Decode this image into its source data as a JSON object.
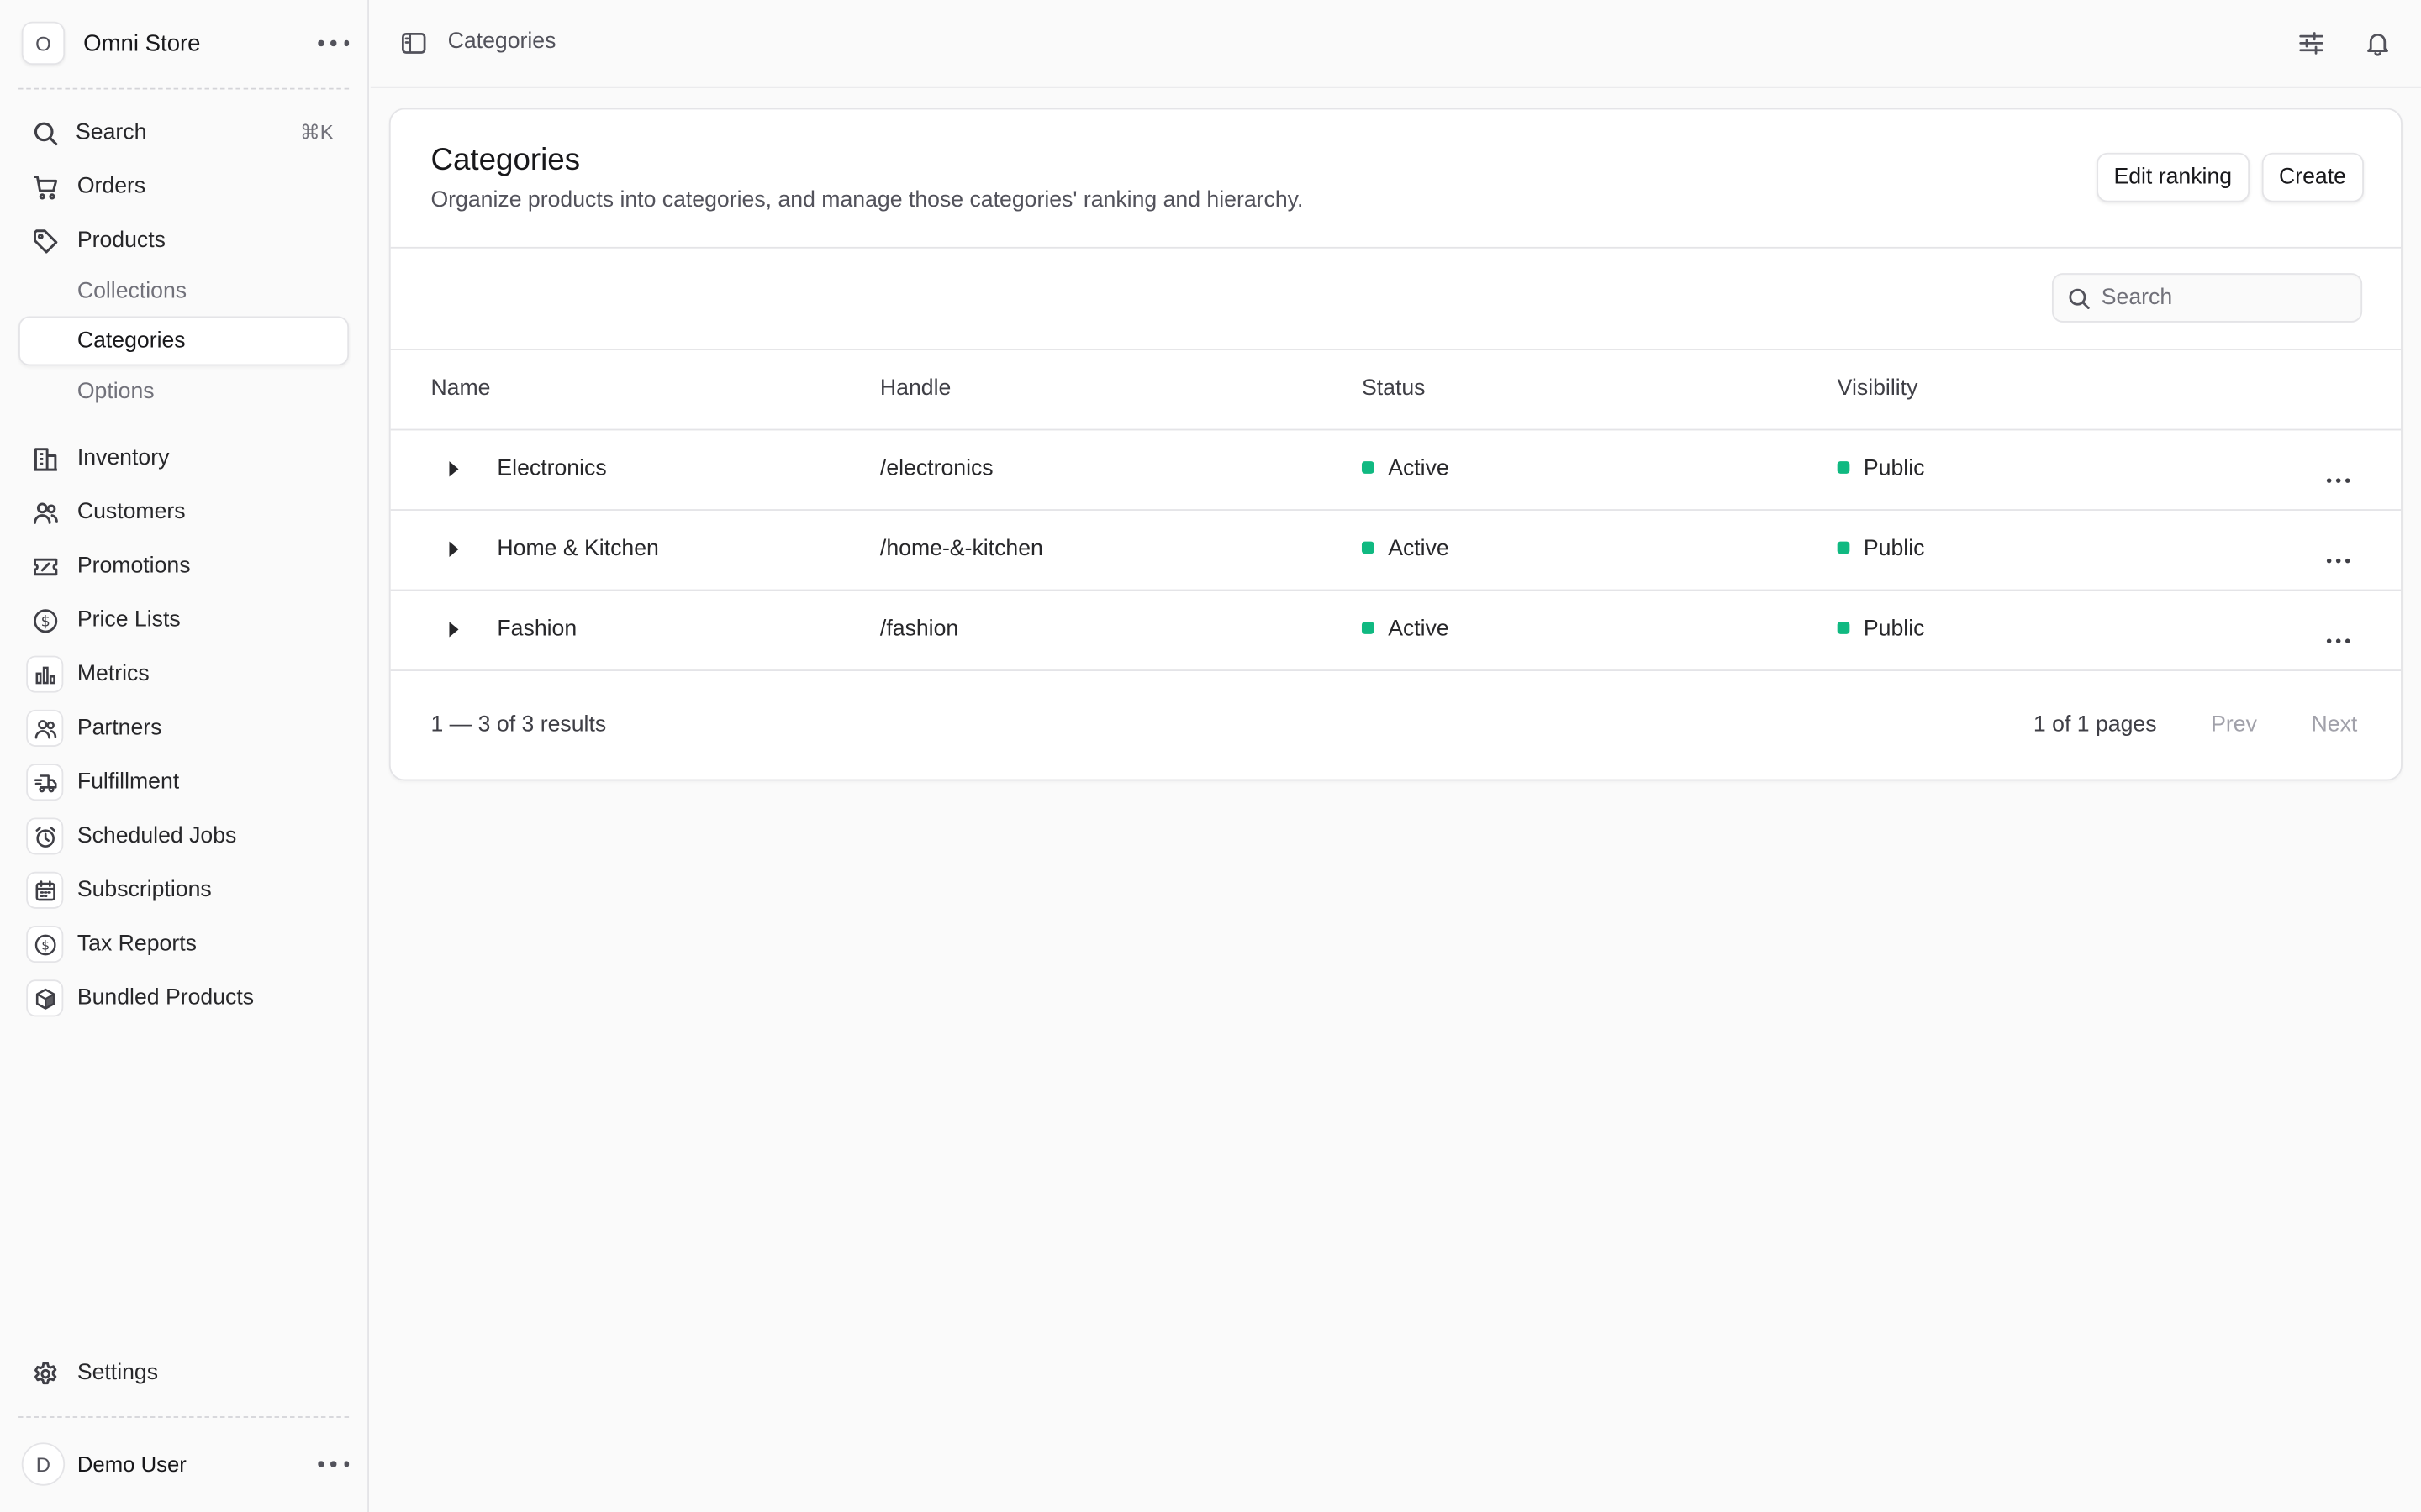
{
  "sidebar": {
    "store_avatar": "O",
    "store_name": "Omni Store",
    "search_label": "Search",
    "search_shortcut": "⌘K",
    "items": [
      {
        "label": "Orders"
      },
      {
        "label": "Products"
      },
      {
        "label": "Collections"
      },
      {
        "label": "Categories"
      },
      {
        "label": "Options"
      },
      {
        "label": "Inventory"
      },
      {
        "label": "Customers"
      },
      {
        "label": "Promotions"
      },
      {
        "label": "Price Lists"
      },
      {
        "label": "Metrics"
      },
      {
        "label": "Partners"
      },
      {
        "label": "Fulfillment"
      },
      {
        "label": "Scheduled Jobs"
      },
      {
        "label": "Subscriptions"
      },
      {
        "label": "Tax Reports"
      },
      {
        "label": "Bundled Products"
      }
    ],
    "settings_label": "Settings",
    "user_avatar": "D",
    "user_name": "Demo User"
  },
  "topbar": {
    "breadcrumb": "Categories"
  },
  "page": {
    "title": "Categories",
    "description": "Organize products into categories, and manage those categories' ranking and hierarchy.",
    "edit_ranking_label": "Edit ranking",
    "create_label": "Create",
    "search_placeholder": "Search"
  },
  "table": {
    "columns": [
      "Name",
      "Handle",
      "Status",
      "Visibility"
    ],
    "rows": [
      {
        "name": "Electronics",
        "handle": "/electronics",
        "status": "Active",
        "visibility": "Public"
      },
      {
        "name": "Home & Kitchen",
        "handle": "/home-&-kitchen",
        "status": "Active",
        "visibility": "Public"
      },
      {
        "name": "Fashion",
        "handle": "/fashion",
        "status": "Active",
        "visibility": "Public"
      }
    ],
    "results_text": "1 — 3 of 3 results",
    "pages_text": "1 of 1 pages",
    "prev_label": "Prev",
    "next_label": "Next"
  },
  "colors": {
    "status_active": "#10b981",
    "border": "#e4e4e7"
  }
}
